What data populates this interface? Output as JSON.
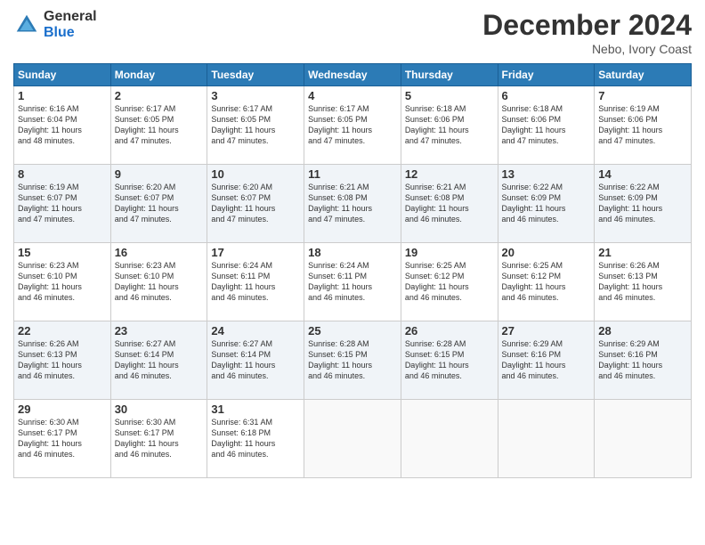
{
  "logo": {
    "general": "General",
    "blue": "Blue"
  },
  "header": {
    "title": "December 2024",
    "location": "Nebo, Ivory Coast"
  },
  "days_of_week": [
    "Sunday",
    "Monday",
    "Tuesday",
    "Wednesday",
    "Thursday",
    "Friday",
    "Saturday"
  ],
  "weeks": [
    [
      {
        "day": "1",
        "info": "Sunrise: 6:16 AM\nSunset: 6:04 PM\nDaylight: 11 hours\nand 48 minutes."
      },
      {
        "day": "2",
        "info": "Sunrise: 6:17 AM\nSunset: 6:05 PM\nDaylight: 11 hours\nand 47 minutes."
      },
      {
        "day": "3",
        "info": "Sunrise: 6:17 AM\nSunset: 6:05 PM\nDaylight: 11 hours\nand 47 minutes."
      },
      {
        "day": "4",
        "info": "Sunrise: 6:17 AM\nSunset: 6:05 PM\nDaylight: 11 hours\nand 47 minutes."
      },
      {
        "day": "5",
        "info": "Sunrise: 6:18 AM\nSunset: 6:06 PM\nDaylight: 11 hours\nand 47 minutes."
      },
      {
        "day": "6",
        "info": "Sunrise: 6:18 AM\nSunset: 6:06 PM\nDaylight: 11 hours\nand 47 minutes."
      },
      {
        "day": "7",
        "info": "Sunrise: 6:19 AM\nSunset: 6:06 PM\nDaylight: 11 hours\nand 47 minutes."
      }
    ],
    [
      {
        "day": "8",
        "info": "Sunrise: 6:19 AM\nSunset: 6:07 PM\nDaylight: 11 hours\nand 47 minutes."
      },
      {
        "day": "9",
        "info": "Sunrise: 6:20 AM\nSunset: 6:07 PM\nDaylight: 11 hours\nand 47 minutes."
      },
      {
        "day": "10",
        "info": "Sunrise: 6:20 AM\nSunset: 6:07 PM\nDaylight: 11 hours\nand 47 minutes."
      },
      {
        "day": "11",
        "info": "Sunrise: 6:21 AM\nSunset: 6:08 PM\nDaylight: 11 hours\nand 47 minutes."
      },
      {
        "day": "12",
        "info": "Sunrise: 6:21 AM\nSunset: 6:08 PM\nDaylight: 11 hours\nand 46 minutes."
      },
      {
        "day": "13",
        "info": "Sunrise: 6:22 AM\nSunset: 6:09 PM\nDaylight: 11 hours\nand 46 minutes."
      },
      {
        "day": "14",
        "info": "Sunrise: 6:22 AM\nSunset: 6:09 PM\nDaylight: 11 hours\nand 46 minutes."
      }
    ],
    [
      {
        "day": "15",
        "info": "Sunrise: 6:23 AM\nSunset: 6:10 PM\nDaylight: 11 hours\nand 46 minutes."
      },
      {
        "day": "16",
        "info": "Sunrise: 6:23 AM\nSunset: 6:10 PM\nDaylight: 11 hours\nand 46 minutes."
      },
      {
        "day": "17",
        "info": "Sunrise: 6:24 AM\nSunset: 6:11 PM\nDaylight: 11 hours\nand 46 minutes."
      },
      {
        "day": "18",
        "info": "Sunrise: 6:24 AM\nSunset: 6:11 PM\nDaylight: 11 hours\nand 46 minutes."
      },
      {
        "day": "19",
        "info": "Sunrise: 6:25 AM\nSunset: 6:12 PM\nDaylight: 11 hours\nand 46 minutes."
      },
      {
        "day": "20",
        "info": "Sunrise: 6:25 AM\nSunset: 6:12 PM\nDaylight: 11 hours\nand 46 minutes."
      },
      {
        "day": "21",
        "info": "Sunrise: 6:26 AM\nSunset: 6:13 PM\nDaylight: 11 hours\nand 46 minutes."
      }
    ],
    [
      {
        "day": "22",
        "info": "Sunrise: 6:26 AM\nSunset: 6:13 PM\nDaylight: 11 hours\nand 46 minutes."
      },
      {
        "day": "23",
        "info": "Sunrise: 6:27 AM\nSunset: 6:14 PM\nDaylight: 11 hours\nand 46 minutes."
      },
      {
        "day": "24",
        "info": "Sunrise: 6:27 AM\nSunset: 6:14 PM\nDaylight: 11 hours\nand 46 minutes."
      },
      {
        "day": "25",
        "info": "Sunrise: 6:28 AM\nSunset: 6:15 PM\nDaylight: 11 hours\nand 46 minutes."
      },
      {
        "day": "26",
        "info": "Sunrise: 6:28 AM\nSunset: 6:15 PM\nDaylight: 11 hours\nand 46 minutes."
      },
      {
        "day": "27",
        "info": "Sunrise: 6:29 AM\nSunset: 6:16 PM\nDaylight: 11 hours\nand 46 minutes."
      },
      {
        "day": "28",
        "info": "Sunrise: 6:29 AM\nSunset: 6:16 PM\nDaylight: 11 hours\nand 46 minutes."
      }
    ],
    [
      {
        "day": "29",
        "info": "Sunrise: 6:30 AM\nSunset: 6:17 PM\nDaylight: 11 hours\nand 46 minutes."
      },
      {
        "day": "30",
        "info": "Sunrise: 6:30 AM\nSunset: 6:17 PM\nDaylight: 11 hours\nand 46 minutes."
      },
      {
        "day": "31",
        "info": "Sunrise: 6:31 AM\nSunset: 6:18 PM\nDaylight: 11 hours\nand 46 minutes."
      },
      {
        "day": "",
        "info": ""
      },
      {
        "day": "",
        "info": ""
      },
      {
        "day": "",
        "info": ""
      },
      {
        "day": "",
        "info": ""
      }
    ]
  ]
}
